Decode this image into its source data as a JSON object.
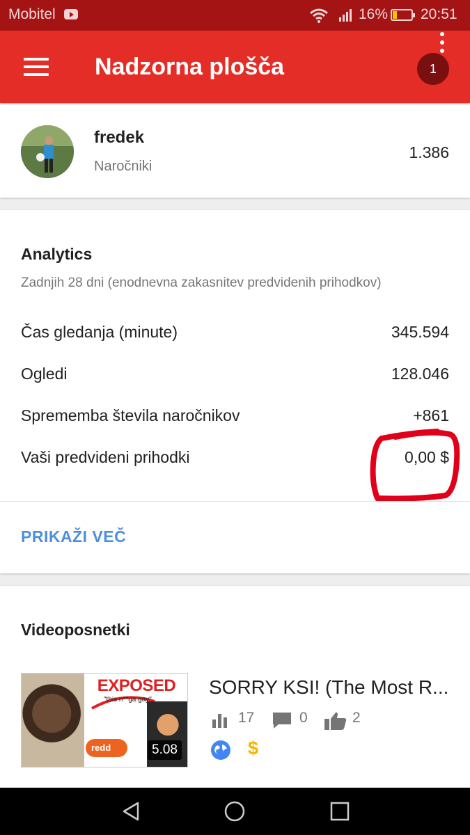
{
  "status_bar": {
    "carrier": "Mobitel",
    "battery": "16%",
    "time": "20:51"
  },
  "app_bar": {
    "title": "Nadzorna plošča",
    "notification_count": "1"
  },
  "profile": {
    "name": "fredek",
    "subtitle": "Naročniki",
    "subscribers": "1.386"
  },
  "analytics": {
    "title": "Analytics",
    "subtitle": "Zadnjih 28 dni (enodnevna zakasnitev predvidenih prihodkov)",
    "rows": [
      {
        "label": "Čas gledanja (minute)",
        "value": "345.594"
      },
      {
        "label": "Ogledi",
        "value": "128.046"
      },
      {
        "label": "Sprememba števila naročnikov",
        "value": "+861"
      },
      {
        "label": "Vaši predvideni prihodki",
        "value": "0,00 $"
      }
    ],
    "show_more": "PRIKAŽI VEČ"
  },
  "videos": {
    "title": "Videoposnetki",
    "items": [
      {
        "title": "SORRY KSI! (The Most R...",
        "duration": "5.08",
        "thumbnail_text": "EXPOSED",
        "thumbnail_quote": "\"this n**ga gay\"",
        "thumbnail_badge": "redd",
        "views": "17",
        "comments": "0",
        "likes": "2",
        "dollar_symbol": "$"
      }
    ]
  },
  "colors": {
    "status_bar": "#a51414",
    "app_bar": "#e52d27",
    "link": "#4a8fe0",
    "highlight": "#e0001a"
  }
}
